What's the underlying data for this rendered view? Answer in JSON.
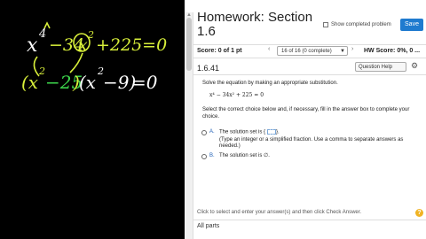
{
  "board": {
    "line1_parts": [
      "x",
      "4",
      "−34",
      "x",
      "2",
      "+225=0"
    ],
    "line2_parts": [
      "(x",
      "2",
      "−25",
      ")",
      "(x",
      "2",
      "−9)",
      "=0"
    ],
    "colors": {
      "chalk": "#ffffff",
      "yellow_green": "#d8ef3a",
      "green": "#3bd24a"
    }
  },
  "page": {
    "title": "Homework: Section 1.6",
    "show_completed": "Show completed problem",
    "save": "Save",
    "score": "Score: 0 of 1 pt",
    "question_select": "16 of 16 (0 complete)",
    "hw_score": "HW Score: 0%, 0 ...",
    "question_number": "1.6.41",
    "question_help": "Question Help",
    "instruction": "Solve the equation by making an appropriate substitution.",
    "equation": "x⁴ − 34x² + 225 = 0",
    "choice_instruction": "Select the correct choice below and, if necessary, fill in the answer box to complete your choice.",
    "option_a_letter": "A.",
    "option_a_line1": "The solution set is {",
    "option_a_line1_end": "}.",
    "option_a_line2": "(Type an integer or a simplified fraction. Use a comma to separate answers as needed.)",
    "option_b_letter": "B.",
    "option_b_text": "The solution set is ∅.",
    "footer_note": "Click to select and enter your answer(s) and then click Check Answer.",
    "all_parts": "All parts",
    "help_symbol": "?",
    "accent": "#1f7bcf"
  }
}
